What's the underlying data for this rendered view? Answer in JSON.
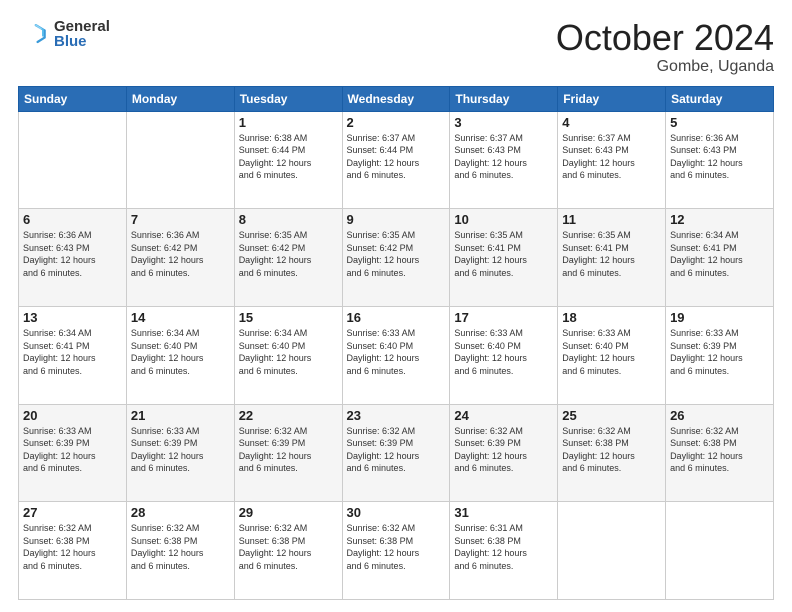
{
  "logo": {
    "general": "General",
    "blue": "Blue"
  },
  "header": {
    "month": "October 2024",
    "location": "Gombe, Uganda"
  },
  "weekdays": [
    "Sunday",
    "Monday",
    "Tuesday",
    "Wednesday",
    "Thursday",
    "Friday",
    "Saturday"
  ],
  "weeks": [
    [
      {
        "day": "",
        "info": ""
      },
      {
        "day": "",
        "info": ""
      },
      {
        "day": "1",
        "info": "Sunrise: 6:38 AM\nSunset: 6:44 PM\nDaylight: 12 hours\nand 6 minutes."
      },
      {
        "day": "2",
        "info": "Sunrise: 6:37 AM\nSunset: 6:44 PM\nDaylight: 12 hours\nand 6 minutes."
      },
      {
        "day": "3",
        "info": "Sunrise: 6:37 AM\nSunset: 6:43 PM\nDaylight: 12 hours\nand 6 minutes."
      },
      {
        "day": "4",
        "info": "Sunrise: 6:37 AM\nSunset: 6:43 PM\nDaylight: 12 hours\nand 6 minutes."
      },
      {
        "day": "5",
        "info": "Sunrise: 6:36 AM\nSunset: 6:43 PM\nDaylight: 12 hours\nand 6 minutes."
      }
    ],
    [
      {
        "day": "6",
        "info": "Sunrise: 6:36 AM\nSunset: 6:43 PM\nDaylight: 12 hours\nand 6 minutes."
      },
      {
        "day": "7",
        "info": "Sunrise: 6:36 AM\nSunset: 6:42 PM\nDaylight: 12 hours\nand 6 minutes."
      },
      {
        "day": "8",
        "info": "Sunrise: 6:35 AM\nSunset: 6:42 PM\nDaylight: 12 hours\nand 6 minutes."
      },
      {
        "day": "9",
        "info": "Sunrise: 6:35 AM\nSunset: 6:42 PM\nDaylight: 12 hours\nand 6 minutes."
      },
      {
        "day": "10",
        "info": "Sunrise: 6:35 AM\nSunset: 6:41 PM\nDaylight: 12 hours\nand 6 minutes."
      },
      {
        "day": "11",
        "info": "Sunrise: 6:35 AM\nSunset: 6:41 PM\nDaylight: 12 hours\nand 6 minutes."
      },
      {
        "day": "12",
        "info": "Sunrise: 6:34 AM\nSunset: 6:41 PM\nDaylight: 12 hours\nand 6 minutes."
      }
    ],
    [
      {
        "day": "13",
        "info": "Sunrise: 6:34 AM\nSunset: 6:41 PM\nDaylight: 12 hours\nand 6 minutes."
      },
      {
        "day": "14",
        "info": "Sunrise: 6:34 AM\nSunset: 6:40 PM\nDaylight: 12 hours\nand 6 minutes."
      },
      {
        "day": "15",
        "info": "Sunrise: 6:34 AM\nSunset: 6:40 PM\nDaylight: 12 hours\nand 6 minutes."
      },
      {
        "day": "16",
        "info": "Sunrise: 6:33 AM\nSunset: 6:40 PM\nDaylight: 12 hours\nand 6 minutes."
      },
      {
        "day": "17",
        "info": "Sunrise: 6:33 AM\nSunset: 6:40 PM\nDaylight: 12 hours\nand 6 minutes."
      },
      {
        "day": "18",
        "info": "Sunrise: 6:33 AM\nSunset: 6:40 PM\nDaylight: 12 hours\nand 6 minutes."
      },
      {
        "day": "19",
        "info": "Sunrise: 6:33 AM\nSunset: 6:39 PM\nDaylight: 12 hours\nand 6 minutes."
      }
    ],
    [
      {
        "day": "20",
        "info": "Sunrise: 6:33 AM\nSunset: 6:39 PM\nDaylight: 12 hours\nand 6 minutes."
      },
      {
        "day": "21",
        "info": "Sunrise: 6:33 AM\nSunset: 6:39 PM\nDaylight: 12 hours\nand 6 minutes."
      },
      {
        "day": "22",
        "info": "Sunrise: 6:32 AM\nSunset: 6:39 PM\nDaylight: 12 hours\nand 6 minutes."
      },
      {
        "day": "23",
        "info": "Sunrise: 6:32 AM\nSunset: 6:39 PM\nDaylight: 12 hours\nand 6 minutes."
      },
      {
        "day": "24",
        "info": "Sunrise: 6:32 AM\nSunset: 6:39 PM\nDaylight: 12 hours\nand 6 minutes."
      },
      {
        "day": "25",
        "info": "Sunrise: 6:32 AM\nSunset: 6:38 PM\nDaylight: 12 hours\nand 6 minutes."
      },
      {
        "day": "26",
        "info": "Sunrise: 6:32 AM\nSunset: 6:38 PM\nDaylight: 12 hours\nand 6 minutes."
      }
    ],
    [
      {
        "day": "27",
        "info": "Sunrise: 6:32 AM\nSunset: 6:38 PM\nDaylight: 12 hours\nand 6 minutes."
      },
      {
        "day": "28",
        "info": "Sunrise: 6:32 AM\nSunset: 6:38 PM\nDaylight: 12 hours\nand 6 minutes."
      },
      {
        "day": "29",
        "info": "Sunrise: 6:32 AM\nSunset: 6:38 PM\nDaylight: 12 hours\nand 6 minutes."
      },
      {
        "day": "30",
        "info": "Sunrise: 6:32 AM\nSunset: 6:38 PM\nDaylight: 12 hours\nand 6 minutes."
      },
      {
        "day": "31",
        "info": "Sunrise: 6:31 AM\nSunset: 6:38 PM\nDaylight: 12 hours\nand 6 minutes."
      },
      {
        "day": "",
        "info": ""
      },
      {
        "day": "",
        "info": ""
      }
    ]
  ]
}
